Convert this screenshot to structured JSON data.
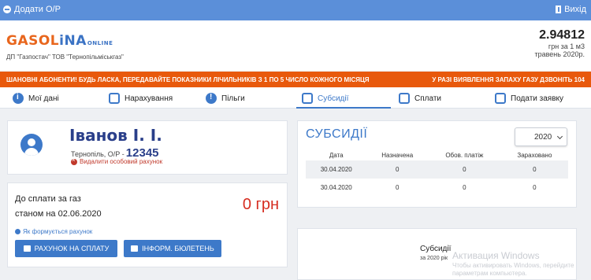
{
  "topbar": {
    "add_label": "Додати О/Р",
    "exit_label": "Вихід"
  },
  "header": {
    "logo_part1": "GASOL",
    "logo_part2": "iNA",
    "logo_online": "ONLINE",
    "company": "ДП \"Газпостач\" ТОВ \"Тернопільміськгаз\"",
    "price_value": "2.94812",
    "price_unit": "грн за 1 м3",
    "price_date": "травень 2020р."
  },
  "banner": {
    "left": "ШАНОВНІ АБОНЕНТИ! БУДЬ ЛАСКА, ПЕРЕДАВАЙТЕ ПОКАЗНИКИ ЛІЧИЛЬНИКІВ З 1 ПО 5 ЧИСЛО КОЖНОГО МІСЯЦЯ",
    "right": "У РАЗІ ВИЯВЛЕННЯ ЗАПАХУ ГАЗУ ДЗВОНІТЬ 104"
  },
  "nav": {
    "tabs": [
      {
        "label": "Мої дані",
        "icon": "info-circle-icon"
      },
      {
        "label": "Нарахування",
        "icon": "document-icon"
      },
      {
        "label": "Пільги",
        "icon": "warning-icon"
      },
      {
        "label": "Субсидії",
        "icon": "folder-icon"
      },
      {
        "label": "Сплати",
        "icon": "gas-icon"
      },
      {
        "label": "Подати заявку",
        "icon": "edit-icon"
      }
    ],
    "active": "Субсидії"
  },
  "profile": {
    "name": "Іванов І. І.",
    "city": "Тернопіль, О/Р -",
    "account": "12345",
    "delete_label": "Видалити особовий рахунок"
  },
  "payment": {
    "due_line1": "До сплати за газ",
    "due_line2": "станом на 02.06.2020",
    "amount": "0 грн",
    "how_link": "Як формується рахунок",
    "btn_invoice": "РАХУНОК НА СПЛАТУ",
    "btn_bulletin": "ІНФОРМ. БЮЛЕТЕНЬ"
  },
  "subsidies": {
    "title": "СУБСИДІЇ",
    "year": "2020",
    "columns": [
      "Дата",
      "Назначена",
      "Обов. платіж",
      "Зараховано"
    ],
    "rows": [
      [
        "30.04.2020",
        "0",
        "0",
        "0"
      ],
      [
        "30.04.2020",
        "0",
        "0",
        "0"
      ]
    ]
  },
  "subsidy_chart": {
    "caption": "Субсидії",
    "subcaption": "за 2020 рік"
  },
  "watermark": {
    "title": "Активация Windows",
    "line1": "Чтобы активировать Windows, перейдите",
    "line2": "параметрам компьютера."
  },
  "colors": {
    "primary": "#3d79c9",
    "topbar": "#5b8fd9",
    "banner": "#e8590c",
    "amount": "#d62d20"
  }
}
